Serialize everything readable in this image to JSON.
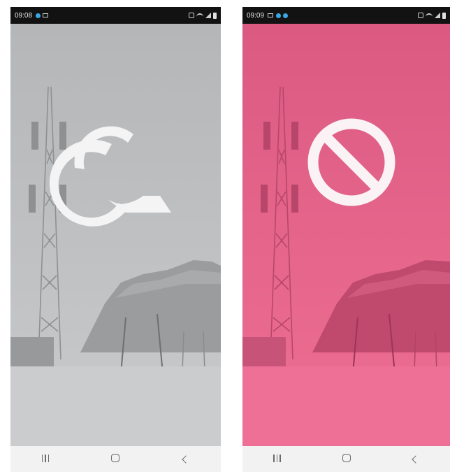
{
  "screens": [
    {
      "id": "left",
      "status_bar": {
        "time": "09:08"
      },
      "overlay_color": "#b7b9bb",
      "center_icon": "app-logo-icon",
      "nav": [
        "recent-apps-icon",
        "home-icon",
        "back-icon"
      ]
    },
    {
      "id": "right",
      "status_bar": {
        "time": "09:09"
      },
      "overlay_color": "#e35a86",
      "center_icon": "blocked-icon",
      "nav": [
        "recent-apps-icon",
        "home-icon",
        "back-icon"
      ]
    }
  ]
}
